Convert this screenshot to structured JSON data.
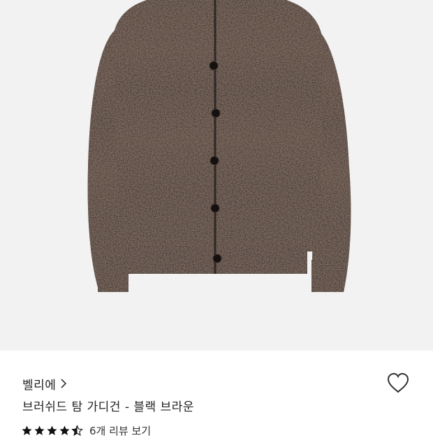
{
  "product": {
    "image_alt": "dark brown knit cardigan",
    "brand": "벨리에",
    "brand_chevron_icon": "chevron-right-icon",
    "title": "브러쉬드 탐 가디건 - 블랙 브라운",
    "wishlist_icon": "heart-outline-icon",
    "rating": 4.5,
    "rating_max": 5,
    "review_link": "6개 리뷰 보기"
  },
  "colors": {
    "image_background": "#f2f2f2",
    "knit_base": "#2b211b",
    "star": "#111111",
    "text": "#222222"
  }
}
